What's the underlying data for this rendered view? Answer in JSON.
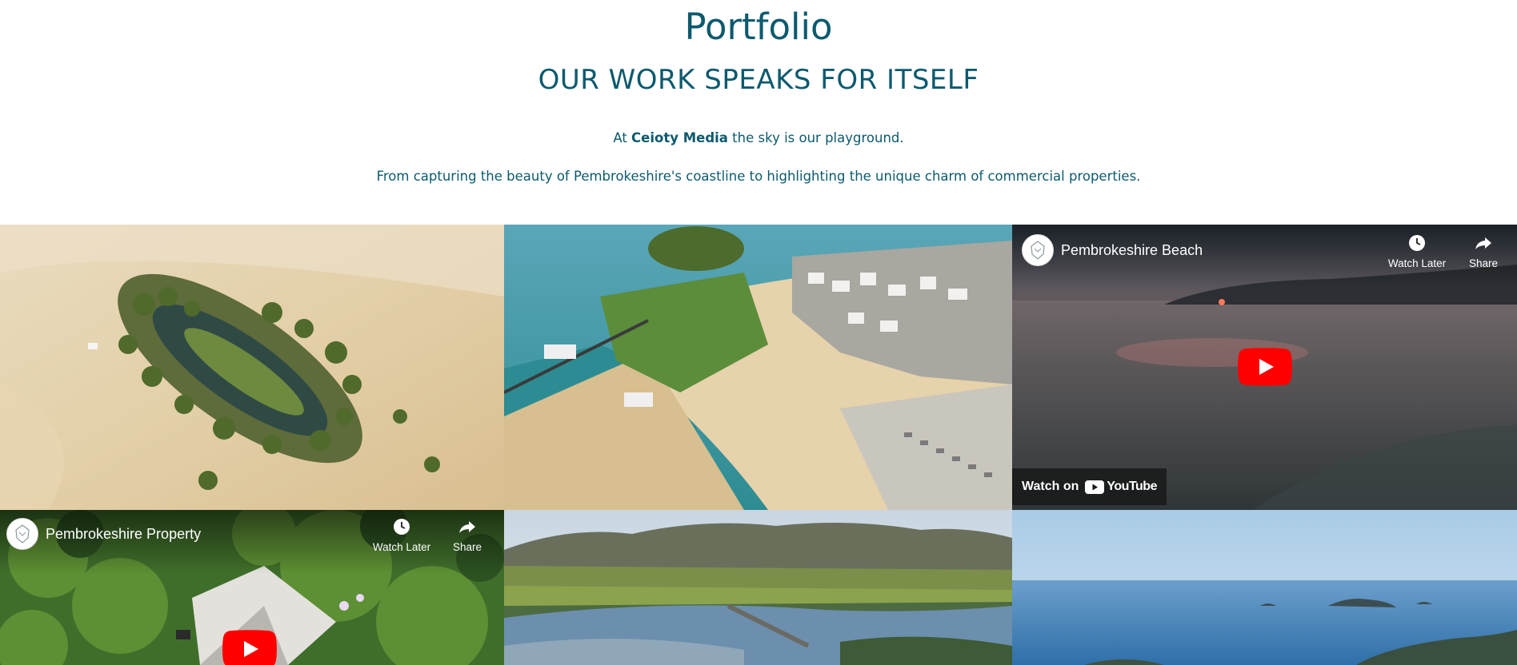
{
  "header": {
    "title": "Portfolio",
    "subtitle": "OUR WORK SPEAKS FOR ITSELF",
    "intro_prefix": "At ",
    "intro_brand": "Ceioty Media",
    "intro_suffix": " the sky is our playground.",
    "description": "From capturing the beauty of Pembrokeshire's coastline to highlighting the unique charm of commercial properties."
  },
  "colors": {
    "brand_teal": "#0d5a6e",
    "youtube_red": "#ff0000"
  },
  "gallery": {
    "videos": [
      {
        "title": "Pembrokeshire Beach",
        "watch_later_label": "Watch Later",
        "share_label": "Share",
        "watch_on_label": "Watch on",
        "youtube_label": "YouTube"
      },
      {
        "title": "Pembrokeshire Property",
        "watch_later_label": "Watch Later",
        "share_label": "Share"
      }
    ]
  }
}
